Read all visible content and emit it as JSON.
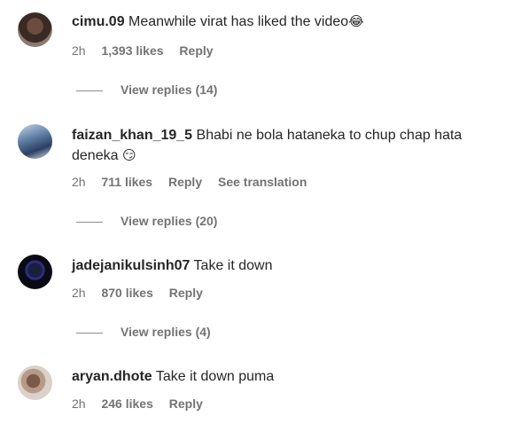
{
  "comments": [
    {
      "username": "cimu.09",
      "text": "Meanwhile virat has liked the video",
      "emoji": "😂",
      "time": "2h",
      "likes": "1,393 likes",
      "reply": "Reply",
      "view_replies": "View replies (14)"
    },
    {
      "username": "faizan_khan_19_5",
      "text": "Bhabi ne bola hataneka to chup chap hata deneka",
      "emoji": "😏",
      "time": "2h",
      "likes": "711 likes",
      "reply": "Reply",
      "see_translation": "See translation",
      "view_replies": "View replies (20)"
    },
    {
      "username": "jadejanikulsinh07",
      "text": "Take it down",
      "time": "2h",
      "likes": "870 likes",
      "reply": "Reply",
      "view_replies": "View replies (4)"
    },
    {
      "username": "aryan.dhote",
      "text": "Take it down puma",
      "time": "2h",
      "likes": "246 likes",
      "reply": "Reply"
    }
  ]
}
